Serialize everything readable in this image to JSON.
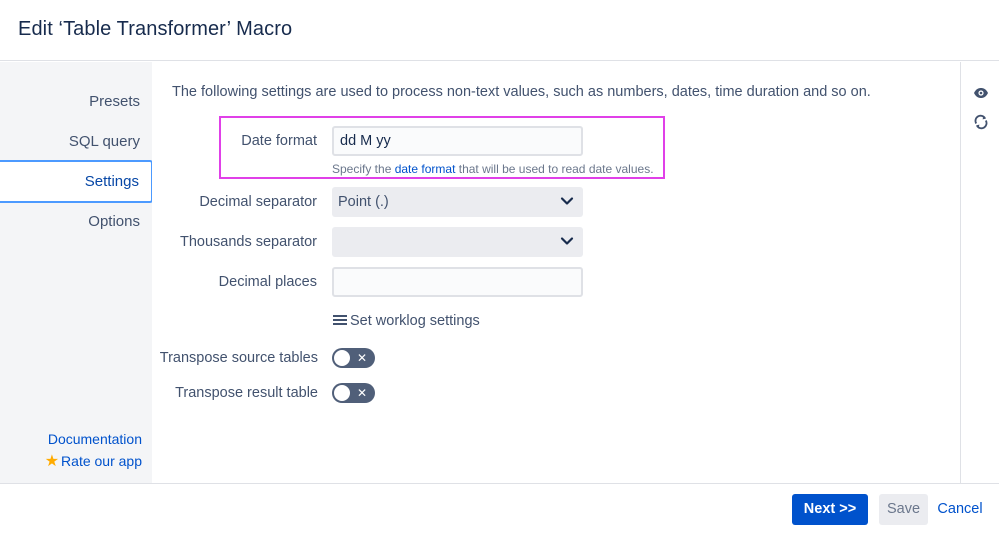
{
  "header": {
    "title": "Edit ‘Table Transformer’ Macro"
  },
  "sidebar": {
    "items": [
      {
        "label": "Presets",
        "active": false
      },
      {
        "label": "SQL query",
        "active": false
      },
      {
        "label": "Settings",
        "active": true
      },
      {
        "label": "Options",
        "active": false
      }
    ],
    "documentation_link": "Documentation",
    "rate_link": "Rate our app"
  },
  "main": {
    "intro": "The following settings are used to process non-text values, such as numbers, dates, time duration and so on.",
    "date_format": {
      "label": "Date format",
      "value": "dd M yy",
      "help_prefix": "Specify the ",
      "help_link": "date format",
      "help_suffix": " that will be used to read date values."
    },
    "decimal_separator": {
      "label": "Decimal separator",
      "value": "Point (.)"
    },
    "thousands_separator": {
      "label": "Thousands separator",
      "value": ""
    },
    "decimal_places": {
      "label": "Decimal places",
      "value": ""
    },
    "worklog_link": "Set worklog settings",
    "transpose_source": {
      "label": "Transpose source tables",
      "enabled": false
    },
    "transpose_result": {
      "label": "Transpose result table",
      "enabled": false
    }
  },
  "rightbar": {
    "icons": [
      "eye-icon",
      "refresh-icon"
    ]
  },
  "footer": {
    "next_label": "Next >>",
    "save_label": "Save",
    "cancel_label": "Cancel"
  },
  "colors": {
    "accent": "#0052cc",
    "highlight": "#e040e8",
    "sidebar_bg": "#f4f5f7"
  }
}
